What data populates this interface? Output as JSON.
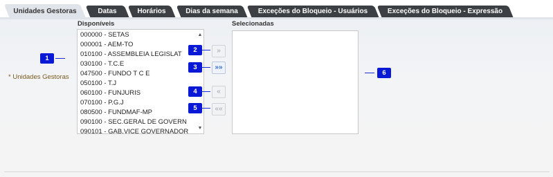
{
  "tabs": [
    {
      "label": "Unidades Gestoras",
      "active": true
    },
    {
      "label": "Datas",
      "active": false
    },
    {
      "label": "Horários",
      "active": false
    },
    {
      "label": "Dias da semana",
      "active": false
    },
    {
      "label": "Exceções do Bloqueio - Usuários",
      "active": false
    },
    {
      "label": "Exceções do Bloqueio - Expressão",
      "active": false
    }
  ],
  "form": {
    "field_label": "* Unidades Gestoras",
    "available_label": "Disponíveis",
    "selected_label": "Selecionadas",
    "available_items": [
      "000000 - SETAS",
      "000001 - AEM-TO",
      "010100 - ASSEMBLEIA LEGISLAT",
      "030100 - T.C.E",
      "047500 - FUNDO T C E",
      "050100 - T.J",
      "060100 - FUNJURIS",
      "070100 - P.G.J",
      "080500 - FUNDMAF-MP",
      "090100 - SEC.GERAL DE GOVERN",
      "090101 - GAB.VICE GOVERNADOR"
    ],
    "selected_items": []
  },
  "buttons": {
    "move_one_right": "»",
    "move_all_right": "»»",
    "move_one_left": "«",
    "move_all_left": "««"
  },
  "icons": {
    "scroll_up": "▲",
    "scroll_down": "▼"
  },
  "annotations": [
    "1",
    "2",
    "3",
    "4",
    "5",
    "6"
  ],
  "colors": {
    "tab_dark": "#3c3f44",
    "tab_active": "#dfe3ea",
    "badge": "#0a19d6",
    "active_arrow": "#2e6fd8",
    "required_label": "#7a5a1e"
  }
}
